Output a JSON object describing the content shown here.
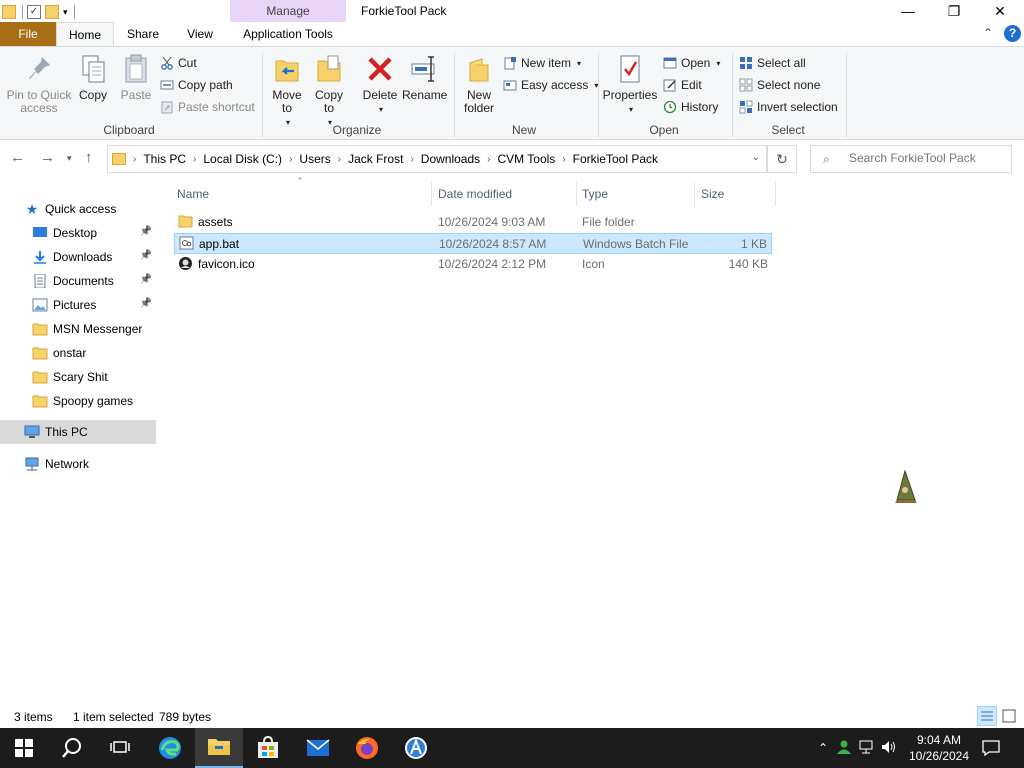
{
  "window": {
    "title": "ForkieTool Pack",
    "contextual_tab_group": "Manage",
    "controls": {
      "minimize": "—",
      "maximize": "❐",
      "close": "✕"
    }
  },
  "ribbon_tabs": [
    "File",
    "Home",
    "Share",
    "View",
    "Application Tools"
  ],
  "ribbon": {
    "clipboard": {
      "label": "Clipboard",
      "pin_to_quick_access": "Pin to Quick access",
      "copy": "Copy",
      "paste": "Paste",
      "cut": "Cut",
      "copy_path": "Copy path",
      "paste_shortcut": "Paste shortcut"
    },
    "organize": {
      "label": "Organize",
      "move_to": "Move to",
      "copy_to": "Copy to",
      "delete": "Delete",
      "rename": "Rename"
    },
    "new": {
      "label": "New",
      "new_folder": "New folder",
      "new_item": "New item",
      "easy_access": "Easy access"
    },
    "open": {
      "label": "Open",
      "properties": "Properties",
      "open": "Open",
      "edit": "Edit",
      "history": "History"
    },
    "select": {
      "label": "Select",
      "select_all": "Select all",
      "select_none": "Select none",
      "invert_selection": "Invert selection"
    }
  },
  "address": {
    "breadcrumbs": [
      "This PC",
      "Local Disk (C:)",
      "Users",
      "Jack Frost",
      "Downloads",
      "CVM Tools",
      "ForkieTool Pack"
    ],
    "search_placeholder": "Search ForkieTool Pack"
  },
  "nav_pane": {
    "quick_access": "Quick access",
    "items": [
      {
        "label": "Desktop",
        "icon": "desktop-icon",
        "pinned": true
      },
      {
        "label": "Downloads",
        "icon": "download-icon",
        "pinned": true
      },
      {
        "label": "Documents",
        "icon": "documents-icon",
        "pinned": true
      },
      {
        "label": "Pictures",
        "icon": "pictures-icon",
        "pinned": true
      },
      {
        "label": "MSN Messenger",
        "icon": "folder-icon",
        "pinned": false
      },
      {
        "label": "onstar",
        "icon": "folder-icon",
        "pinned": false
      },
      {
        "label": "Scary Shit",
        "icon": "folder-icon",
        "pinned": false
      },
      {
        "label": "Spoopy games",
        "icon": "folder-icon",
        "pinned": false
      }
    ],
    "this_pc": "This PC",
    "network": "Network"
  },
  "file_list": {
    "columns": [
      "Name",
      "Date modified",
      "Type",
      "Size"
    ],
    "rows": [
      {
        "name": "assets",
        "date": "10/26/2024 9:03 AM",
        "type": "File folder",
        "size": "",
        "icon": "folder-icon",
        "selected": false
      },
      {
        "name": "app.bat",
        "date": "10/26/2024 8:57 AM",
        "type": "Windows Batch File",
        "size": "1 KB",
        "icon": "batch-file-icon",
        "selected": true
      },
      {
        "name": "favicon.ico",
        "date": "10/26/2024 2:12 PM",
        "type": "Icon",
        "size": "140 KB",
        "icon": "ico-file-icon",
        "selected": false
      }
    ]
  },
  "status": {
    "items_count": "3 items",
    "selection": "1 item selected",
    "selection_size": "789 bytes"
  },
  "taskbar": {
    "time": "9:04 AM",
    "date": "10/26/2024"
  },
  "colors": {
    "file_tab": "#a86e16",
    "manage_tab": "#e8d4f7",
    "selection": "#cce8ff",
    "taskbar": "#1c1c1c"
  }
}
